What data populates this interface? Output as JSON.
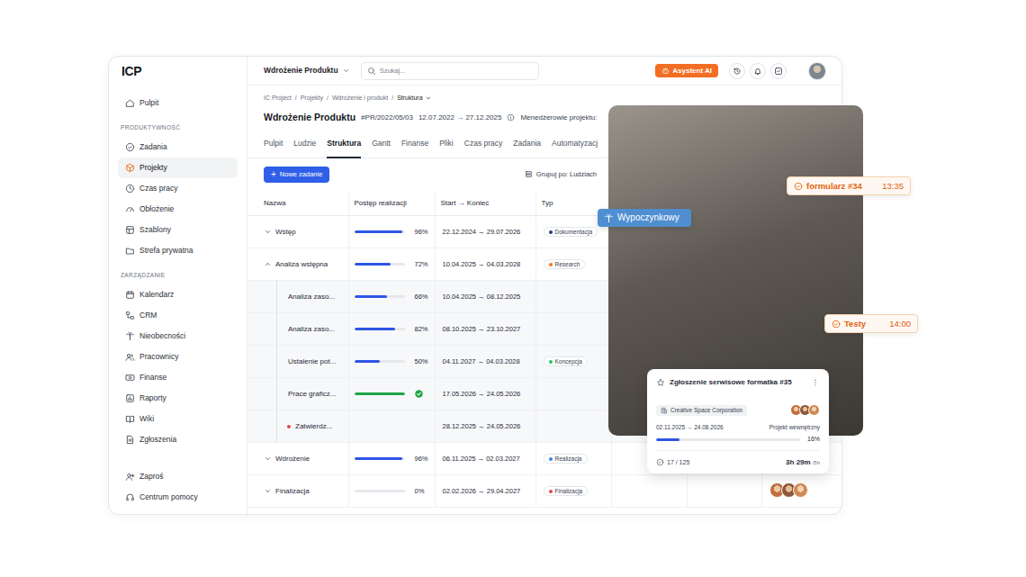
{
  "sidebar": {
    "logo": "ICP",
    "top_items": [
      {
        "label": "Pulpit",
        "selected": false
      }
    ],
    "sections": [
      {
        "heading": "PRODUKTYWNOŚĆ",
        "items": [
          {
            "label": "Zadania",
            "selected": false
          },
          {
            "label": "Projekty",
            "selected": true
          },
          {
            "label": "Czas pracy",
            "selected": false
          },
          {
            "label": "Obłożenie",
            "selected": false
          },
          {
            "label": "Szablony",
            "selected": false
          },
          {
            "label": "Strefa prywatna",
            "selected": false
          }
        ]
      },
      {
        "heading": "ZARZĄDZANIE",
        "items": [
          {
            "label": "Kalendarz",
            "selected": false
          },
          {
            "label": "CRM",
            "selected": false
          },
          {
            "label": "Nieobecności",
            "selected": false
          },
          {
            "label": "Pracownicy",
            "selected": false
          },
          {
            "label": "Finanse",
            "selected": false
          },
          {
            "label": "Raporty",
            "selected": false
          },
          {
            "label": "Wiki",
            "selected": false
          },
          {
            "label": "Zgłoszenia",
            "selected": false
          }
        ]
      }
    ],
    "bottom_items": [
      {
        "label": "Zaproś",
        "selected": false
      },
      {
        "label": "Centrum pomocy",
        "selected": false
      }
    ]
  },
  "topbar": {
    "project": "Wdrożenie Produktu",
    "search": {
      "placeholder": "Szukaj..."
    },
    "ai_button": "Asystent AI"
  },
  "breadcrumb": {
    "items": [
      "IC Project",
      "Projekty",
      "Wdrożenie i produkt",
      "Struktura"
    ],
    "separator": "/"
  },
  "header": {
    "title": "Wdrożenie Produktu",
    "code": "#PR/2022/05/03",
    "dates": "12.07.2022 → 27.12.2025",
    "managers_label": "Menedżerowie projektu:"
  },
  "tabs": [
    {
      "label": "Pulpit",
      "selected": false
    },
    {
      "label": "Ludzie",
      "selected": false
    },
    {
      "label": "Struktura",
      "selected": true
    },
    {
      "label": "Gantt",
      "selected": false
    },
    {
      "label": "Finanse",
      "selected": false
    },
    {
      "label": "Pliki",
      "selected": false
    },
    {
      "label": "Czas pracy",
      "selected": false
    },
    {
      "label": "Zadania",
      "selected": false
    },
    {
      "label": "Automatyzacj",
      "selected": false
    }
  ],
  "toolbar": {
    "new_task": {
      "icon": "+",
      "label": "Nowe zadanie"
    },
    "group_by": "Grupuj po: Ludziach"
  },
  "table": {
    "columns": [
      "Nazwa",
      "Postęp realizacji",
      "Start → Koniec",
      "Typ"
    ],
    "groups": [
      {
        "name": "Wstęp",
        "expanded": false,
        "progress": {
          "level": 0.96,
          "reading": "96%"
        },
        "dates": "22.12.2024 → 29.07.2026",
        "type": {
          "label": "Dokumentacja",
          "color": "#1e3a8a"
        },
        "team": 0,
        "children": []
      },
      {
        "name": "Analiza wstępna",
        "expanded": true,
        "progress": {
          "level": 0.72,
          "reading": "72%"
        },
        "dates": "10.04.2025 → 04.03.2028",
        "type": {
          "label": "Research",
          "color": "#f97316"
        },
        "team": 0,
        "children": [
          {
            "kind": "task",
            "name": "Analiza zaso...",
            "progress": {
              "level": 0.66,
              "reading": "66%"
            },
            "dates": "10.04.2025 → 08.12.2025"
          },
          {
            "kind": "task",
            "name": "Analiza zaso...",
            "progress": {
              "level": 0.82,
              "reading": "82%"
            },
            "dates": "08.10.2025 → 23.10.2027"
          },
          {
            "kind": "task",
            "name": "Ustalenie pot...",
            "progress": {
              "level": 0.5,
              "reading": "50%"
            },
            "dates": "04.11.2027 → 04.03.2028",
            "type": {
              "label": "Koncepcja",
              "color": "#22c55e"
            }
          },
          {
            "kind": "done",
            "name": "Prace graficz...",
            "progress": {
              "level": 1
            },
            "dates": "17.05.2026 → 24.05.2026"
          },
          {
            "kind": "milestone",
            "name": "Zatwierdz...",
            "color": "#e5484d",
            "dates": "28.12.2025 → 24.05.2026"
          }
        ]
      },
      {
        "name": "Wdrożenie",
        "expanded": false,
        "progress": {
          "level": 0.96,
          "reading": "96%"
        },
        "dates": "06.11.2025 → 02.03.2027",
        "type": {
          "label": "Realizacja",
          "color": "#3b82f6"
        },
        "team": 0,
        "children": []
      },
      {
        "name": "Finalizacja",
        "expanded": false,
        "progress": {
          "level": 0,
          "reading": "0%"
        },
        "dates": "02.02.2026 → 29.04.2027",
        "type": {
          "label": "Finalizacja",
          "color": "#ef4444"
        },
        "team": 3,
        "children": []
      }
    ]
  },
  "absence_chip": {
    "label": "Wypoczynkowy"
  },
  "calendar_chips": [
    {
      "label": "formularz #34",
      "time": "13:35"
    },
    {
      "label": "Testy",
      "time": "14:00"
    }
  ],
  "task_card": {
    "title": "Zgłoszenie serwisowe formatka #35",
    "starred": false,
    "client": "Creative Space Corporation",
    "team": 3,
    "dates": "02.11.2025 → 24.08.2026",
    "project_kind": "Projekt wewnętrzny",
    "progress": {
      "level": 0.16,
      "reading": "16%"
    },
    "subtasks": "17 / 125",
    "time": {
      "spent": "3h 29m",
      "limit": "/5h"
    }
  }
}
